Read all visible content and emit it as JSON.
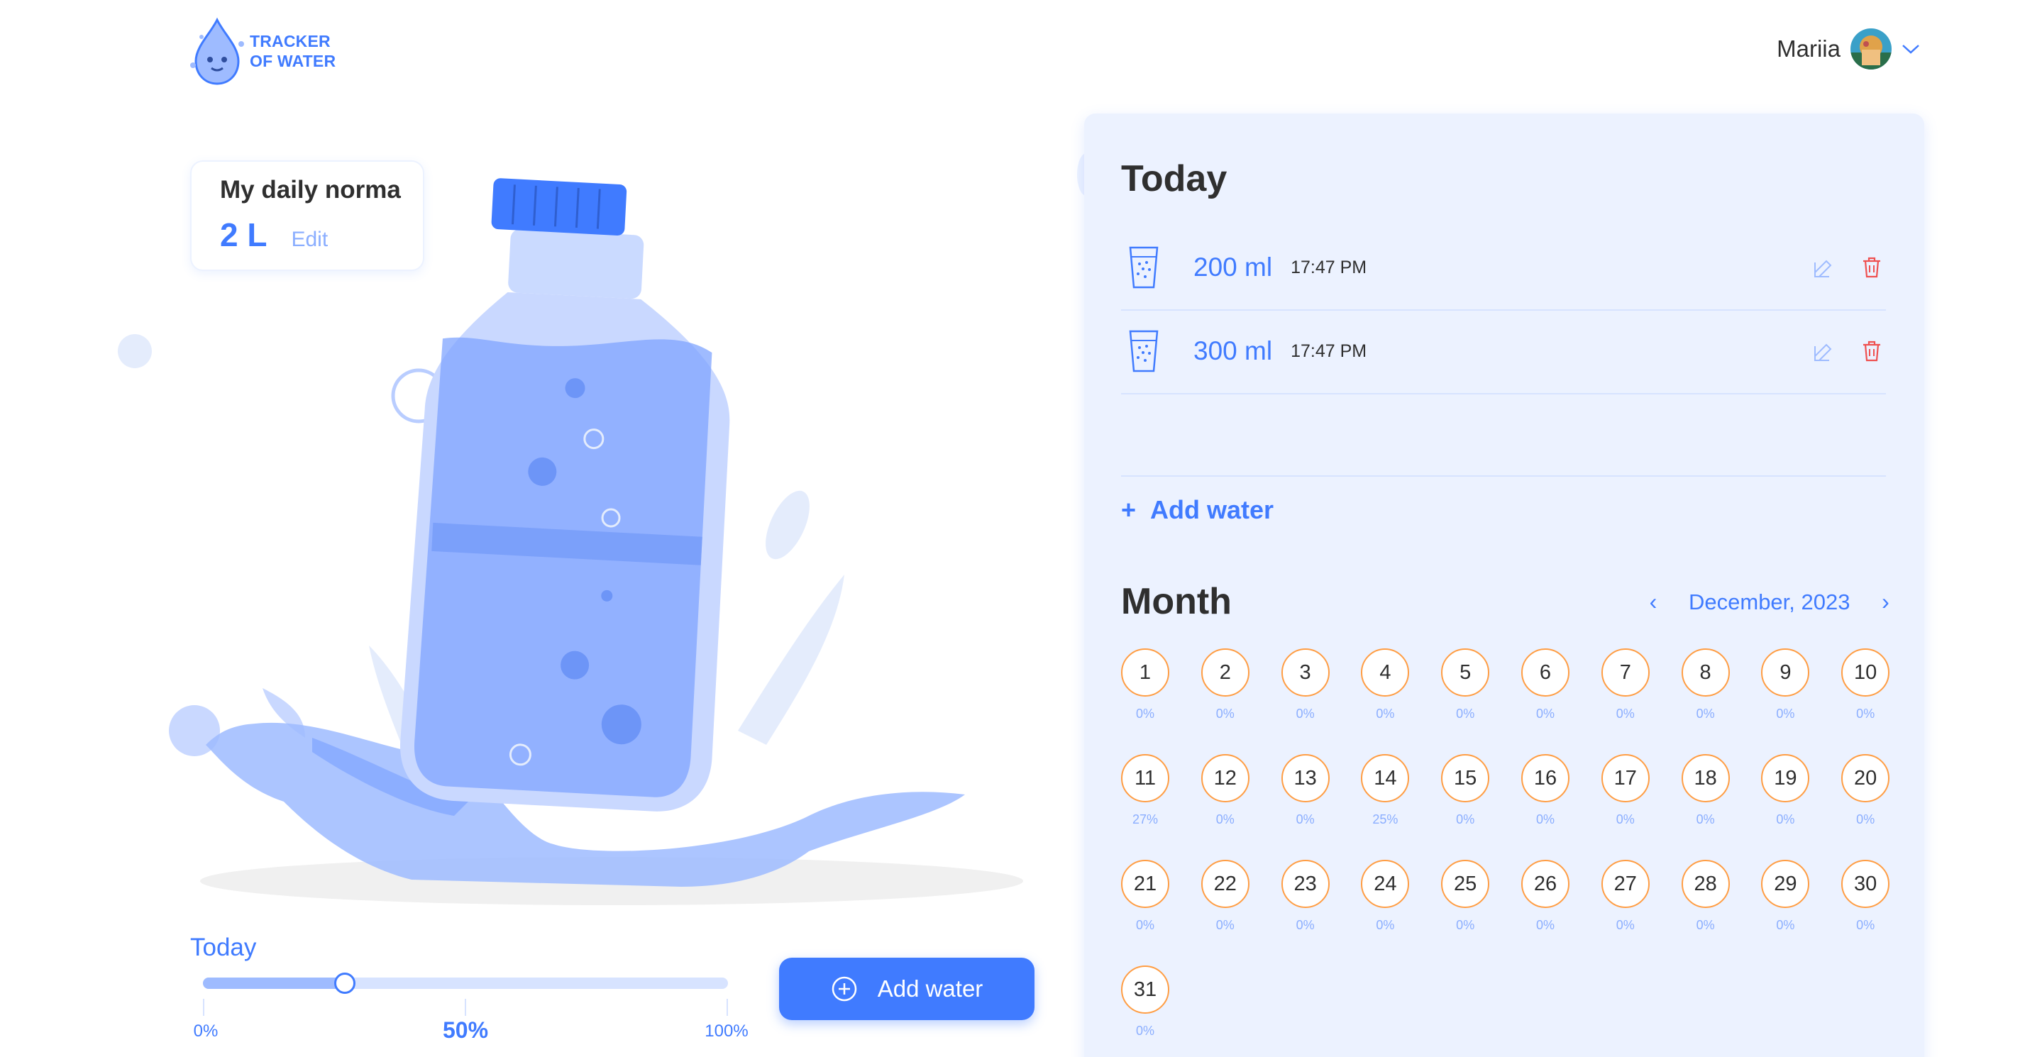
{
  "header": {
    "logo_line1": "TRACKER",
    "logo_line2": "OF WATER",
    "user_name": "Mariia"
  },
  "daily_norma": {
    "title": "My daily norma",
    "value": "2 L",
    "edit_label": "Edit"
  },
  "today_progress": {
    "label": "Today",
    "percent": 27,
    "tick_0": "0%",
    "tick_50": "50%",
    "tick_100": "100%",
    "add_button": "Add water"
  },
  "today_panel": {
    "title": "Today",
    "entries": [
      {
        "amount": "200 ml",
        "time": "17:47 PM"
      },
      {
        "amount": "300 ml",
        "time": "17:47 PM"
      }
    ],
    "add_label": "Add water"
  },
  "month_panel": {
    "title": "Month",
    "month_label": "December, 2023",
    "days": [
      {
        "day": "1",
        "pct": "0%"
      },
      {
        "day": "2",
        "pct": "0%"
      },
      {
        "day": "3",
        "pct": "0%"
      },
      {
        "day": "4",
        "pct": "0%"
      },
      {
        "day": "5",
        "pct": "0%"
      },
      {
        "day": "6",
        "pct": "0%"
      },
      {
        "day": "7",
        "pct": "0%"
      },
      {
        "day": "8",
        "pct": "0%"
      },
      {
        "day": "9",
        "pct": "0%"
      },
      {
        "day": "10",
        "pct": "0%"
      },
      {
        "day": "11",
        "pct": "27%"
      },
      {
        "day": "12",
        "pct": "0%"
      },
      {
        "day": "13",
        "pct": "0%"
      },
      {
        "day": "14",
        "pct": "25%"
      },
      {
        "day": "15",
        "pct": "0%"
      },
      {
        "day": "16",
        "pct": "0%"
      },
      {
        "day": "17",
        "pct": "0%"
      },
      {
        "day": "18",
        "pct": "0%"
      },
      {
        "day": "19",
        "pct": "0%"
      },
      {
        "day": "20",
        "pct": "0%"
      },
      {
        "day": "21",
        "pct": "0%"
      },
      {
        "day": "22",
        "pct": "0%"
      },
      {
        "day": "23",
        "pct": "0%"
      },
      {
        "day": "24",
        "pct": "0%"
      },
      {
        "day": "25",
        "pct": "0%"
      },
      {
        "day": "26",
        "pct": "0%"
      },
      {
        "day": "27",
        "pct": "0%"
      },
      {
        "day": "28",
        "pct": "0%"
      },
      {
        "day": "29",
        "pct": "0%"
      },
      {
        "day": "30",
        "pct": "0%"
      },
      {
        "day": "31",
        "pct": "0%"
      }
    ]
  },
  "colors": {
    "accent": "#407bff",
    "panel_bg": "#ecf2ff",
    "day_border": "#ff9d43",
    "delete": "#ef5050"
  }
}
